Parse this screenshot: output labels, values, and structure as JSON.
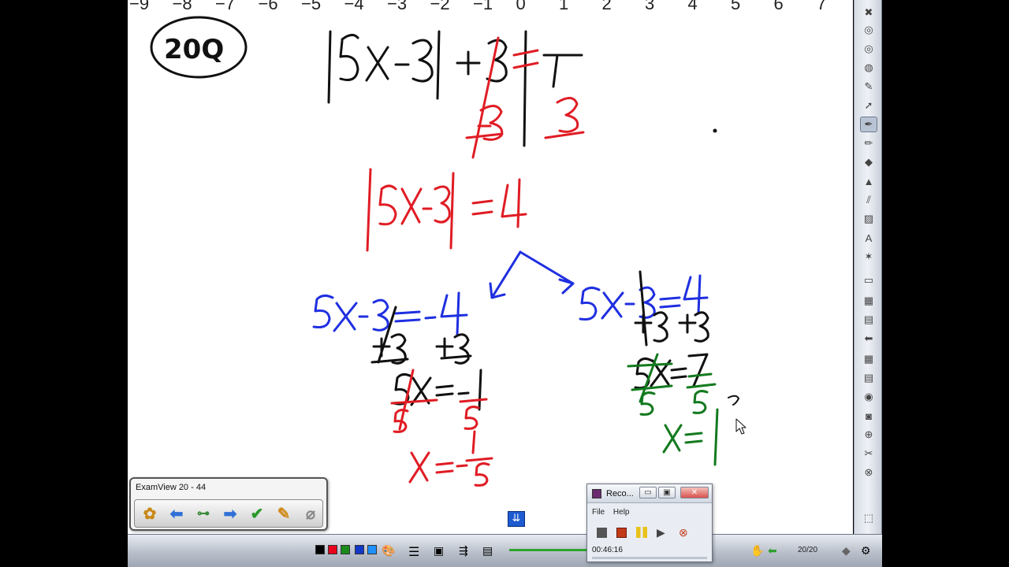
{
  "numberline": {
    "labels": [
      "−9",
      "−8",
      "−7",
      "−6",
      "−5",
      "−4",
      "−3",
      "−2",
      "−1",
      "0",
      "1",
      "2",
      "3",
      "4",
      "5",
      "6",
      "7"
    ]
  },
  "board": {
    "problem_number": "20Q"
  },
  "examview": {
    "title": "ExamView  20 - 44",
    "buttons": [
      "home-icon",
      "back-arrow-icon",
      "tree-icon",
      "forward-arrow-icon",
      "check-icon",
      "clipboard-icon",
      "paperclip-icon"
    ]
  },
  "recorder": {
    "title": "Reco...",
    "menu_file": "File",
    "menu_help": "Help",
    "timer": "00:46:16",
    "minimize": "▭",
    "restore": "▣",
    "close": "✕"
  },
  "taskbar": {
    "colors": [
      "#000000",
      "#e8001c",
      "#1a8a1a",
      "#1238c8",
      "#1e90ff"
    ],
    "page_counter": "20/20"
  },
  "colors": {
    "ink_black": "#111111",
    "ink_red": "#e01c24",
    "ink_blue": "#1f2fe0",
    "ink_green": "#137a1f"
  }
}
